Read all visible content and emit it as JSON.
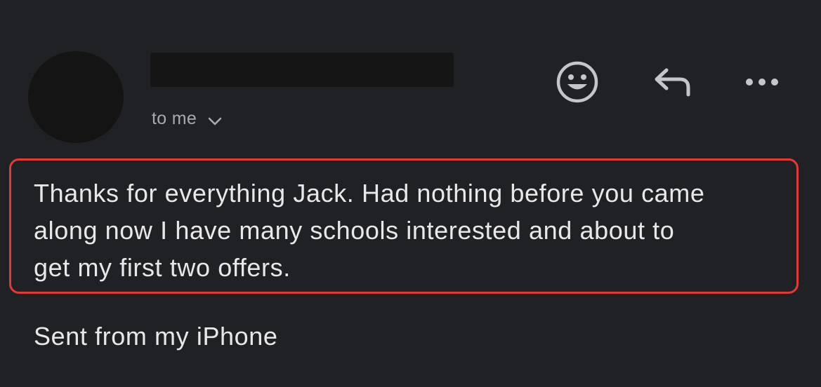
{
  "header": {
    "recipients_label": "to me"
  },
  "actions": {
    "react_icon": "smiley-icon",
    "reply_icon": "reply-icon",
    "more_icon": "more-horizontal-icon"
  },
  "message": {
    "body_lines": [
      "Thanks for everything Jack. Had nothing before you came",
      "along now I have many schools interested and about to",
      "get my first two offers."
    ],
    "signature": "Sent from my iPhone"
  },
  "colors": {
    "background": "#202124",
    "text": "#e8e8ea",
    "secondary_text": "#a8aab0",
    "icon": "#c4c6cc",
    "highlight": "#e53935"
  }
}
